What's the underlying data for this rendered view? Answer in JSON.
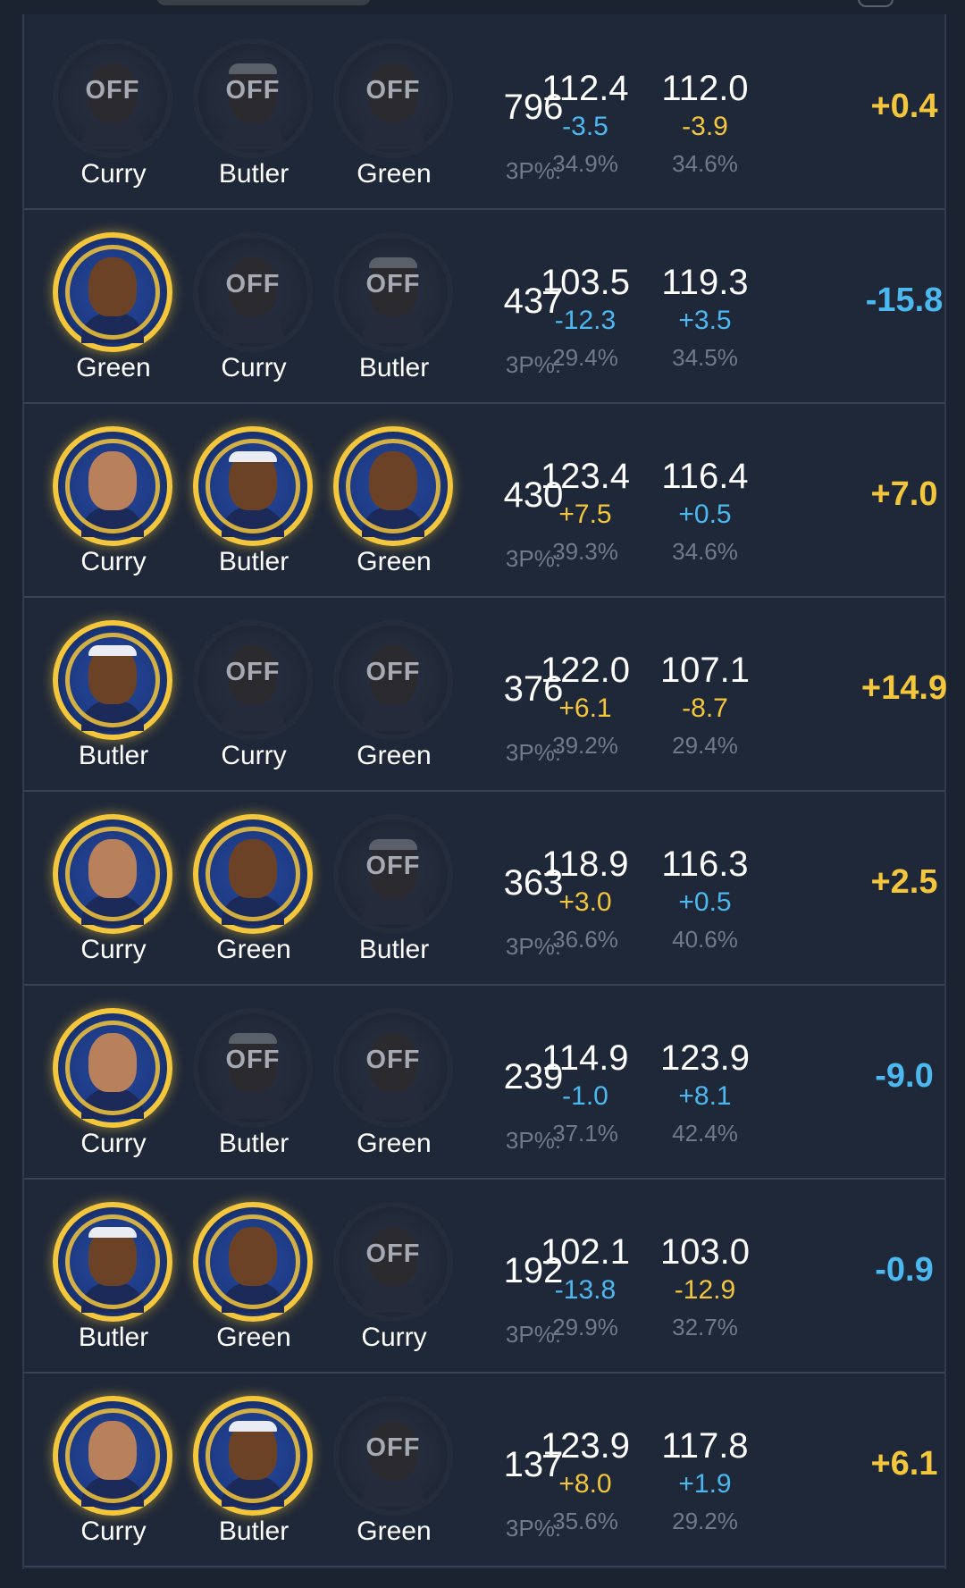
{
  "colors": {
    "positive": "#f3c63b",
    "negative": "#4cb8f0",
    "background": "#1f2839",
    "on_ring": "#f3c63b"
  },
  "icons": {
    "on_court": "player-headshot-icon",
    "off_court": "player-off-icon"
  },
  "off_text": "OFF",
  "rows": [
    {
      "players": [
        {
          "name": "Curry",
          "status": "off"
        },
        {
          "name": "Butler",
          "status": "off"
        },
        {
          "name": "Green",
          "status": "off"
        }
      ],
      "minutes": "796",
      "label_3p": "3P%:",
      "off_rating": "112.4",
      "off_diff": "-3.5",
      "off_diff_sign": "neg",
      "off_3p": "34.9%",
      "def_rating": "112.0",
      "def_diff": "-3.9",
      "def_diff_sign": "pos",
      "def_3p": "34.6%",
      "net": "+0.4",
      "net_sign": "pos"
    },
    {
      "players": [
        {
          "name": "Green",
          "status": "on"
        },
        {
          "name": "Curry",
          "status": "off"
        },
        {
          "name": "Butler",
          "status": "off"
        }
      ],
      "minutes": "437",
      "label_3p": "3P%:",
      "off_rating": "103.5",
      "off_diff": "-12.3",
      "off_diff_sign": "neg",
      "off_3p": "29.4%",
      "def_rating": "119.3",
      "def_diff": "+3.5",
      "def_diff_sign": "neg",
      "def_3p": "34.5%",
      "net": "-15.8",
      "net_sign": "neg"
    },
    {
      "players": [
        {
          "name": "Curry",
          "status": "on"
        },
        {
          "name": "Butler",
          "status": "on"
        },
        {
          "name": "Green",
          "status": "on"
        }
      ],
      "minutes": "430",
      "label_3p": "3P%:",
      "off_rating": "123.4",
      "off_diff": "+7.5",
      "off_diff_sign": "pos",
      "off_3p": "39.3%",
      "def_rating": "116.4",
      "def_diff": "+0.5",
      "def_diff_sign": "neg",
      "def_3p": "34.6%",
      "net": "+7.0",
      "net_sign": "pos"
    },
    {
      "players": [
        {
          "name": "Butler",
          "status": "on"
        },
        {
          "name": "Curry",
          "status": "off"
        },
        {
          "name": "Green",
          "status": "off"
        }
      ],
      "minutes": "376",
      "label_3p": "3P%:",
      "off_rating": "122.0",
      "off_diff": "+6.1",
      "off_diff_sign": "pos",
      "off_3p": "39.2%",
      "def_rating": "107.1",
      "def_diff": "-8.7",
      "def_diff_sign": "pos",
      "def_3p": "29.4%",
      "net": "+14.9",
      "net_sign": "pos"
    },
    {
      "players": [
        {
          "name": "Curry",
          "status": "on"
        },
        {
          "name": "Green",
          "status": "on"
        },
        {
          "name": "Butler",
          "status": "off"
        }
      ],
      "minutes": "363",
      "label_3p": "3P%:",
      "off_rating": "118.9",
      "off_diff": "+3.0",
      "off_diff_sign": "pos",
      "off_3p": "36.6%",
      "def_rating": "116.3",
      "def_diff": "+0.5",
      "def_diff_sign": "neg",
      "def_3p": "40.6%",
      "net": "+2.5",
      "net_sign": "pos"
    },
    {
      "players": [
        {
          "name": "Curry",
          "status": "on"
        },
        {
          "name": "Butler",
          "status": "off"
        },
        {
          "name": "Green",
          "status": "off"
        }
      ],
      "minutes": "239",
      "label_3p": "3P%:",
      "off_rating": "114.9",
      "off_diff": "-1.0",
      "off_diff_sign": "neg",
      "off_3p": "37.1%",
      "def_rating": "123.9",
      "def_diff": "+8.1",
      "def_diff_sign": "neg",
      "def_3p": "42.4%",
      "net": "-9.0",
      "net_sign": "neg"
    },
    {
      "players": [
        {
          "name": "Butler",
          "status": "on"
        },
        {
          "name": "Green",
          "status": "on"
        },
        {
          "name": "Curry",
          "status": "off"
        }
      ],
      "minutes": "192",
      "label_3p": "3P%:",
      "off_rating": "102.1",
      "off_diff": "-13.8",
      "off_diff_sign": "neg",
      "off_3p": "29.9%",
      "def_rating": "103.0",
      "def_diff": "-12.9",
      "def_diff_sign": "pos",
      "def_3p": "32.7%",
      "net": "-0.9",
      "net_sign": "neg"
    },
    {
      "players": [
        {
          "name": "Curry",
          "status": "on"
        },
        {
          "name": "Butler",
          "status": "on"
        },
        {
          "name": "Green",
          "status": "off"
        }
      ],
      "minutes": "137",
      "label_3p": "3P%:",
      "off_rating": "123.9",
      "off_diff": "+8.0",
      "off_diff_sign": "pos",
      "off_3p": "35.6%",
      "def_rating": "117.8",
      "def_diff": "+1.9",
      "def_diff_sign": "neg",
      "def_3p": "29.2%",
      "net": "+6.1",
      "net_sign": "pos"
    }
  ]
}
